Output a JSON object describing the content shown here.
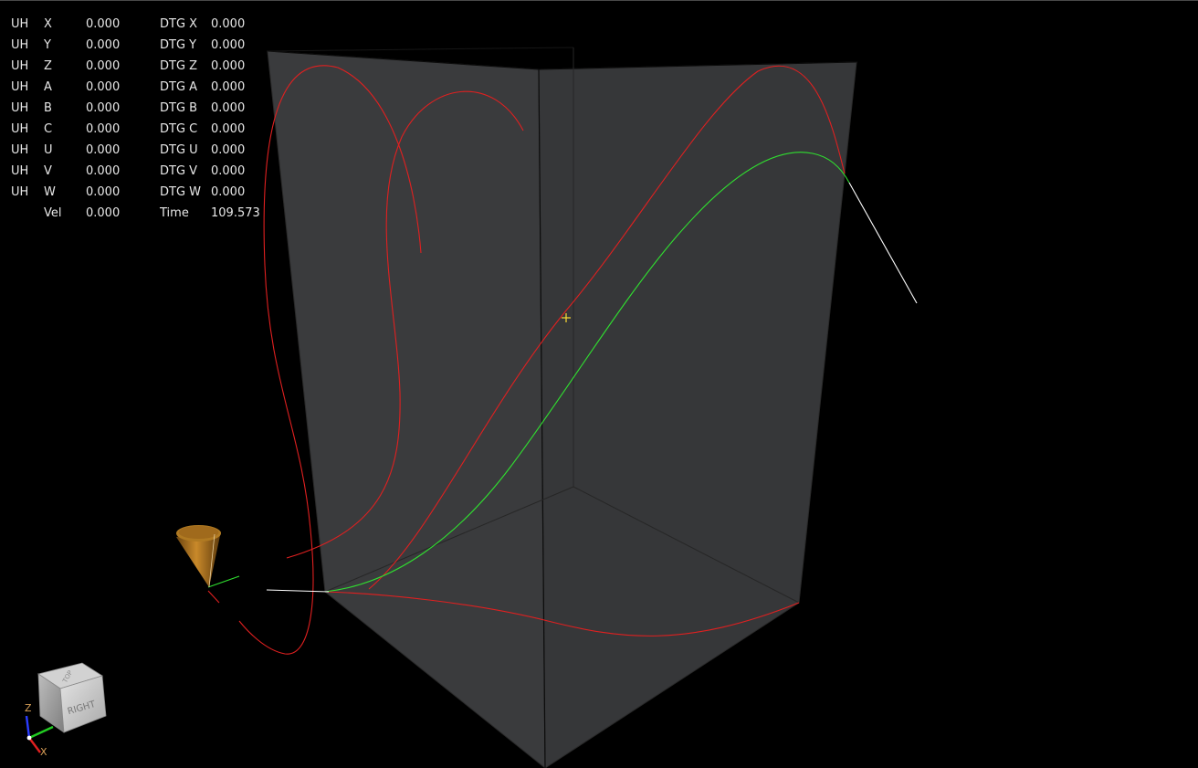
{
  "dro": {
    "rows": [
      {
        "hdr": "UH",
        "axis": "X",
        "value": "0.000",
        "dtg_label": "DTG X",
        "dtg_value": "0.000"
      },
      {
        "hdr": "UH",
        "axis": "Y",
        "value": "0.000",
        "dtg_label": "DTG Y",
        "dtg_value": "0.000"
      },
      {
        "hdr": "UH",
        "axis": "Z",
        "value": "0.000",
        "dtg_label": "DTG Z",
        "dtg_value": "0.000"
      },
      {
        "hdr": "UH",
        "axis": "A",
        "value": "0.000",
        "dtg_label": "DTG A",
        "dtg_value": "0.000"
      },
      {
        "hdr": "UH",
        "axis": "B",
        "value": "0.000",
        "dtg_label": "DTG B",
        "dtg_value": "0.000"
      },
      {
        "hdr": "UH",
        "axis": "C",
        "value": "0.000",
        "dtg_label": "DTG C",
        "dtg_value": "0.000"
      },
      {
        "hdr": "UH",
        "axis": "U",
        "value": "0.000",
        "dtg_label": "DTG U",
        "dtg_value": "0.000"
      },
      {
        "hdr": "UH",
        "axis": "V",
        "value": "0.000",
        "dtg_label": "DTG V",
        "dtg_value": "0.000"
      },
      {
        "hdr": "UH",
        "axis": "W",
        "value": "0.000",
        "dtg_label": "DTG W",
        "dtg_value": "0.000"
      }
    ],
    "vel_label": "Vel",
    "vel_value": "0.000",
    "time_label": "Time",
    "time_value": "109.573"
  },
  "view_cube": {
    "face_label": "RIGHT",
    "top_label": "TOP",
    "axis_z_label": "Z",
    "axis_x_label": "X"
  },
  "colors": {
    "background": "#000000",
    "stock_box": "#3a3b3d",
    "feed_path": "#e02020",
    "current_path": "#30e030",
    "rapid_path": "#ffffff",
    "tool_cone": "#a06a1c",
    "origin_cross": "#ffdd33"
  },
  "icons": {
    "tool": "cone-tool-icon",
    "view_cube": "view-cube-icon",
    "axis_triad": "axis-triad-icon",
    "origin": "crosshair-icon"
  }
}
